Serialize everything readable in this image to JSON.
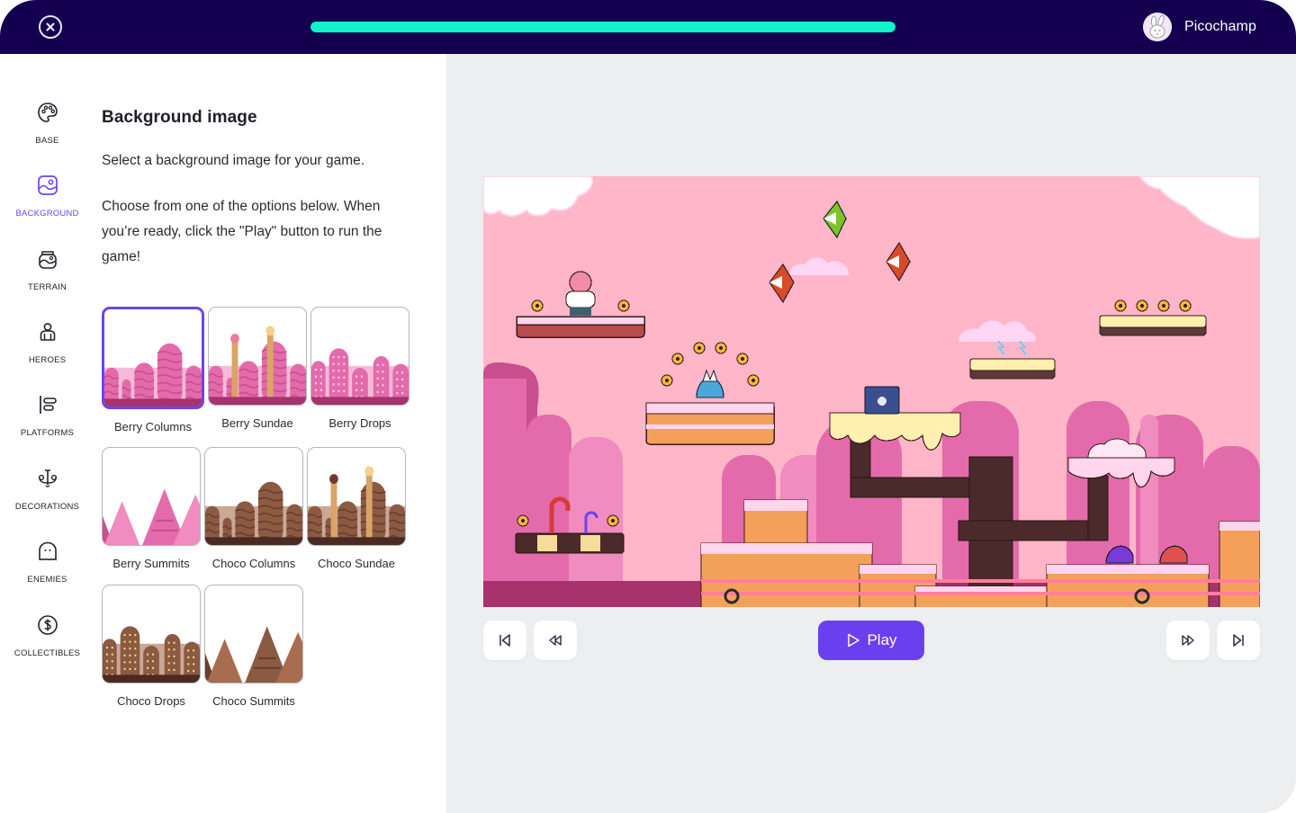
{
  "topbar": {
    "close_label": "Close",
    "progress_fraction": 1.0,
    "progress_color": "#10f5c8",
    "user": {
      "name": "Picochamp",
      "avatar_icon": "bunny-avatar"
    }
  },
  "sidebar": {
    "active": "background",
    "accent_color": "#6a44ef",
    "items": [
      {
        "id": "base",
        "label": "BASE",
        "icon": "palette-icon"
      },
      {
        "id": "background",
        "label": "BACKGROUND",
        "icon": "image-icon"
      },
      {
        "id": "terrain",
        "label": "TERRAIN",
        "icon": "terrain-jar-icon"
      },
      {
        "id": "heroes",
        "label": "HEROES",
        "icon": "person-icon"
      },
      {
        "id": "platforms",
        "label": "PLATFORMS",
        "icon": "align-left-bars-icon"
      },
      {
        "id": "decorations",
        "label": "DECORATIONS",
        "icon": "chandelier-icon"
      },
      {
        "id": "enemies",
        "label": "ENEMIES",
        "icon": "ghost-icon"
      },
      {
        "id": "collectibles",
        "label": "COLLECTIBLES",
        "icon": "dollar-coin-icon"
      }
    ]
  },
  "panel": {
    "title": "Background image",
    "intro": "Select a background image for your game.",
    "instructions": "Choose from one of the options below. When you’re ready, click the \"Play\" button to run the game!",
    "selected": "Berry Columns",
    "options": [
      {
        "label": "Berry Columns",
        "theme": "berry",
        "style": "columns"
      },
      {
        "label": "Berry Sundae",
        "theme": "berry",
        "style": "sundae"
      },
      {
        "label": "Berry Drops",
        "theme": "berry",
        "style": "drops"
      },
      {
        "label": "Berry Summits",
        "theme": "berry",
        "style": "summits"
      },
      {
        "label": "Choco Columns",
        "theme": "choco",
        "style": "columns"
      },
      {
        "label": "Choco Sundae",
        "theme": "choco",
        "style": "sundae"
      },
      {
        "label": "Choco Drops",
        "theme": "choco",
        "style": "drops"
      },
      {
        "label": "Choco Summits",
        "theme": "choco",
        "style": "summits"
      }
    ]
  },
  "preview": {
    "scene": "Berry Columns game level preview",
    "controls": {
      "skip_start": "skip-to-start-icon",
      "rewind": "rewind-icon",
      "play_label": "Play",
      "fast_forward": "fast-forward-icon",
      "skip_end": "skip-to-end-icon"
    },
    "play_color": "#6a3ff0"
  }
}
